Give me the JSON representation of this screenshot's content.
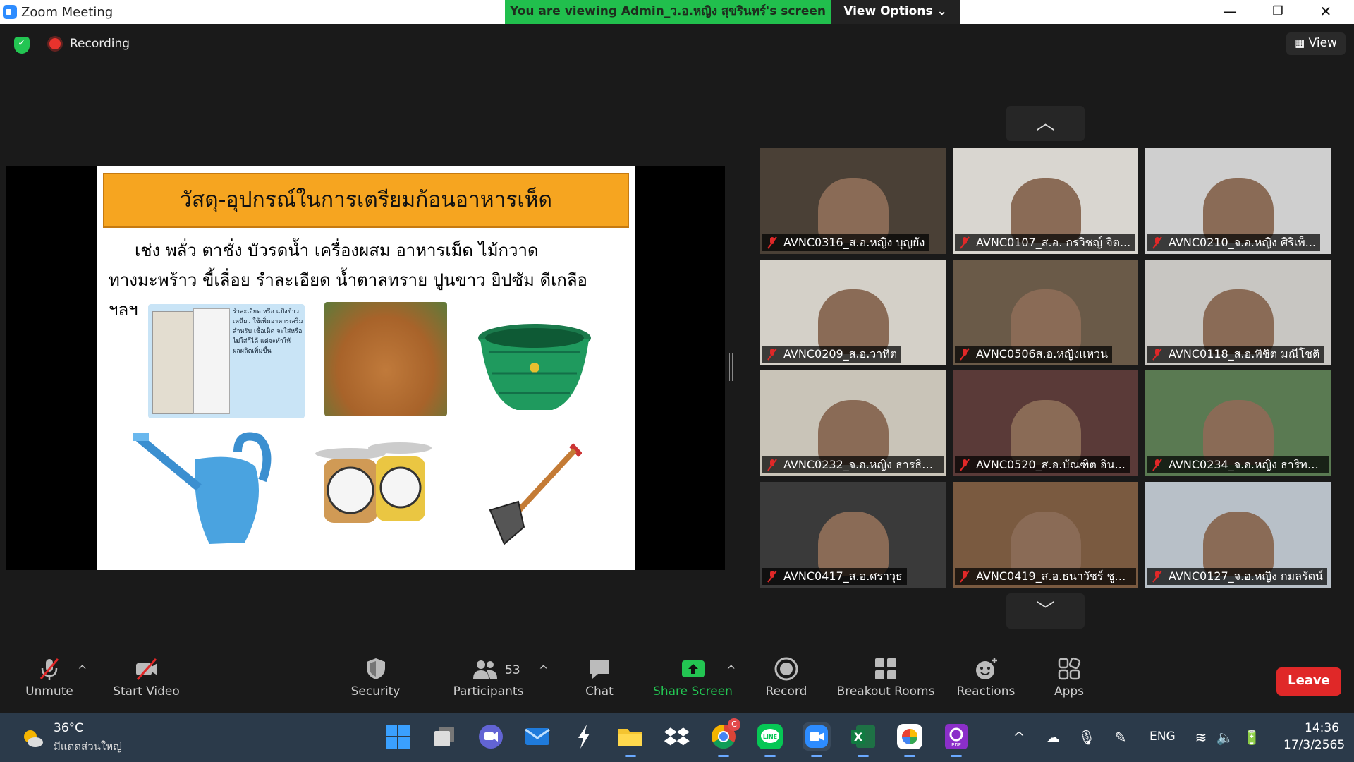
{
  "window": {
    "title": "Zoom Meeting",
    "viewing_banner": "You are viewing Admin_ว.อ.หญิง สุขรินทร์'s screen",
    "view_options": "View Options ⌄"
  },
  "topbar": {
    "recording_label": "Recording",
    "view_label": "View"
  },
  "slide": {
    "title": "วัสดุ-อุปกรณ์ในการเตรียมก้อนอาหารเห็ด",
    "line1": "เช่ง  พลั่ว ตาชั่ง บัวรดน้ำ เครื่องผสม อาหารเม็ด ไม้กวาด",
    "line2": "ทางมะพร้าว ขี้เลื่อย รำละเอียด น้ำตาลทราย ปูนขาว ยิปซัม    ดีเกลือ",
    "line3": "ฯลฯ",
    "bag_caption": "รำละเอียด หรือ แป้งข้าวเหนียว ใช้เพิ่มอาหารเสริมสำหรับ เชื้อเห็ด จะใส่หรือไม่ใส่ก็ได้ แต่จะทำให้ผลผลิตเพิ่มขึ้น"
  },
  "participants": [
    {
      "name": "AVNC0316_ส.อ.หญิง บุญยัง"
    },
    {
      "name": "AVNC0107_ส.อ. กรวิชญ์ จิต..."
    },
    {
      "name": "AVNC0210_จ.อ.หญิง ศิริเพ็..."
    },
    {
      "name": "AVNC0209_ส.อ.วาทิต"
    },
    {
      "name": "AVNC0506ส.อ.หญิงแหวน"
    },
    {
      "name": "AVNC0118_ส.อ.พิชิต มณีโชติ"
    },
    {
      "name": "AVNC0232_จ.อ.หญิง ธารธิด..."
    },
    {
      "name": "AVNC0520_ส.อ.บัณฑิต  อิน..."
    },
    {
      "name": "AVNC0234_จ.อ.หญิง ธาริทพ..."
    },
    {
      "name": "AVNC0417_ส.อ.ศราวุธ"
    },
    {
      "name": "AVNC0419_ส.อ.ธนาวัชร์ ชูช..."
    },
    {
      "name": "AVNC0127_จ.อ.หญิง กมลรัตน์"
    }
  ],
  "toolbar": {
    "unmute": "Unmute",
    "start_video": "Start Video",
    "security": "Security",
    "participants": "Participants",
    "participants_count": "53",
    "chat": "Chat",
    "share_screen": "Share Screen",
    "record": "Record",
    "breakout_rooms": "Breakout Rooms",
    "reactions": "Reactions",
    "apps": "Apps",
    "leave": "Leave"
  },
  "taskbar": {
    "temperature": "36°C",
    "weather": "มีแดดส่วนใหญ่",
    "language": "ENG",
    "time": "14:36",
    "date": "17/3/2565",
    "chrome_badge": "C"
  },
  "colors": {
    "banner": "#21bf4d",
    "leave": "#e02828",
    "share": "#23c552",
    "slide_title": "#f6a520",
    "accent": "#2d8cff"
  }
}
